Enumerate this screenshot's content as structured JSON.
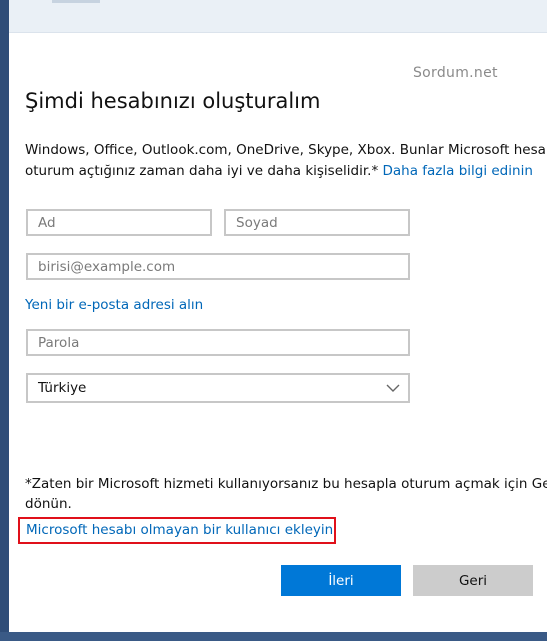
{
  "watermark": "Sordum.net",
  "title": "Şimdi hesabınızı oluşturalım",
  "description": {
    "line1": "Windows, Office, Outlook.com, OneDrive, Skype, Xbox. Bunlar Microsoft hesabınızla",
    "line2": "oturum açtığınız zaman daha iyi ve daha kişiselidir.* ",
    "link": "Daha fazla bilgi edinin"
  },
  "form": {
    "first_name_placeholder": "Ad",
    "last_name_placeholder": "Soyad",
    "email_placeholder": "birisi@example.com",
    "new_email_link": "Yeni bir e-posta adresi alın",
    "password_placeholder": "Parola",
    "country_value": "Türkiye"
  },
  "note": {
    "line1": "*Zaten bir Microsoft hizmeti kullanıyorsanız bu hesapla oturum açmak için Geri",
    "line2": "dönün."
  },
  "no_ms_account_link": "Microsoft hesabı olmayan bir kullanıcı ekleyin",
  "buttons": {
    "next": "İleri",
    "back": "Geri"
  },
  "colors": {
    "accent": "#0078d7",
    "link": "#0067b8",
    "highlight": "#e0101a",
    "background": "#2f4d78"
  }
}
